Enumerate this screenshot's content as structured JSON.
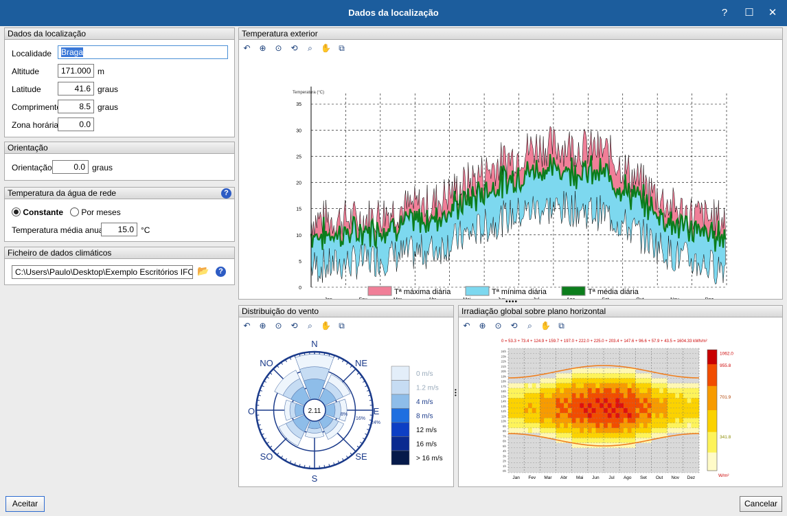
{
  "window": {
    "title": "Dados da localização",
    "help": "?",
    "maximize": "☐",
    "close": "✕"
  },
  "location": {
    "header": "Dados da localização",
    "locality_label": "Localidade",
    "locality_value": "Braga",
    "altitude_label": "Altitude",
    "altitude_value": "171.000",
    "altitude_unit": "m",
    "latitude_label": "Latitude",
    "latitude_value": "41.6",
    "latitude_unit": "graus",
    "longitude_label": "Comprimento",
    "longitude_value": "8.5",
    "longitude_unit": "graus",
    "timezone_label": "Zona horária",
    "timezone_value": "0.0"
  },
  "orientation": {
    "header": "Orientação",
    "label": "Orientação",
    "value": "0.0",
    "unit": "graus"
  },
  "water": {
    "header": "Temperatura da água de rede",
    "opt_constant": "Constante",
    "opt_months": "Por meses",
    "selected": "Constante",
    "annual_label": "Temperatura média anual:",
    "annual_value": "15.0",
    "annual_unit": "°C"
  },
  "climate_file": {
    "header": "Ficheiro de dados climáticos",
    "path": "C:\\Users\\Paulo\\Desktop\\Exemplo Escritórios IFC\\Braga"
  },
  "temp_panel": {
    "header": "Temperatura exterior"
  },
  "wind_panel": {
    "header": "Distribuição do vento"
  },
  "irr_panel": {
    "header": "Irradiação global sobre plano horizontal"
  },
  "toolbar_icons": [
    "zoom-back-icon",
    "zoom-region-icon",
    "zoom-in-icon",
    "zoom-out-icon",
    "zoom-fit-icon",
    "pan-hand-icon",
    "copy-chart-icon"
  ],
  "footer": {
    "accept": "Aceitar",
    "cancel": "Cancelar"
  },
  "colors": {
    "titlebar": "#1c5d9d",
    "tmax": "#f07f98",
    "tmin": "#7dd8ef",
    "tavg": "#0c7d1c"
  },
  "chart_data": [
    {
      "type": "area",
      "ylabel": "Temperatura (°C)",
      "ylim": [
        0,
        37
      ],
      "yticks": [
        0,
        5,
        10,
        15,
        20,
        25,
        30,
        35
      ],
      "categories": [
        "Jan",
        "Fev",
        "Mar",
        "Abr",
        "Mai",
        "Jun",
        "Jul",
        "Ago",
        "Set",
        "Out",
        "Nov",
        "Dez"
      ],
      "grid": true,
      "legend_position": "bottom",
      "series": [
        {
          "name": "Tª máxima diária",
          "color": "#f07f98",
          "values": [
            13,
            13,
            15,
            16,
            20,
            24,
            27,
            27,
            26,
            20,
            15,
            13
          ]
        },
        {
          "name": "Tª mínima diária",
          "color": "#7dd8ef",
          "values": [
            4,
            5,
            6,
            7,
            10,
            13,
            15,
            15,
            14,
            10,
            6,
            4
          ]
        },
        {
          "name": "Tª média diária",
          "color": "#0c7d1c",
          "values": [
            9,
            9,
            10.5,
            11.5,
            15,
            18.5,
            21,
            21,
            20,
            15,
            11,
            9
          ]
        }
      ]
    },
    {
      "type": "polar",
      "directions": [
        "N",
        "NE",
        "E",
        "SE",
        "S",
        "SO",
        "O",
        "NO"
      ],
      "center_value": "2.11",
      "ring_labels": [
        "8%",
        "16%",
        "24%"
      ],
      "speed_bins": [
        "0 m/s",
        "1.2 m/s",
        "4 m/s",
        "8 m/s",
        "12 m/s",
        "16 m/s",
        "> 16 m/s"
      ],
      "bin_colors": [
        "#e3eef9",
        "#c6dcf3",
        "#8ebde9",
        "#1e6fe0",
        "#0d3fc4",
        "#0a2a90",
        "#061a4a"
      ],
      "frequencies": [
        19,
        12,
        9,
        9,
        7,
        12,
        8,
        14
      ]
    },
    {
      "type": "heatmap",
      "xlabels": [
        "Jan",
        "Fev",
        "Mar",
        "Abr",
        "Mai",
        "Jun",
        "Jul",
        "Ago",
        "Set",
        "Out",
        "Nov",
        "Dez"
      ],
      "ylabels": [
        "24h",
        "23h",
        "22h",
        "21h",
        "20h",
        "19h",
        "18h",
        "17h",
        "16h",
        "15h",
        "14h",
        "13h",
        "12h",
        "11h",
        "10h",
        "9h",
        "8h",
        "7h",
        "6h",
        "5h",
        "4h",
        "3h",
        "2h",
        "1h",
        "0h"
      ],
      "totals_label": "0 = 53.3 + 73.4 + 124.9 + 159.7 + 197.0 + 222.0 + 225.0 + 203.4 + 147.6 + 96.6 + 57.9 + 43.5 = 1604.33 kWh/m²",
      "colorbar_ticks": [
        "1062.0",
        "955.8",
        "701.9",
        "341.8"
      ],
      "unit": "W/m²",
      "monthly_peak": [
        420,
        520,
        650,
        780,
        880,
        940,
        960,
        900,
        760,
        600,
        460,
        390
      ]
    }
  ]
}
